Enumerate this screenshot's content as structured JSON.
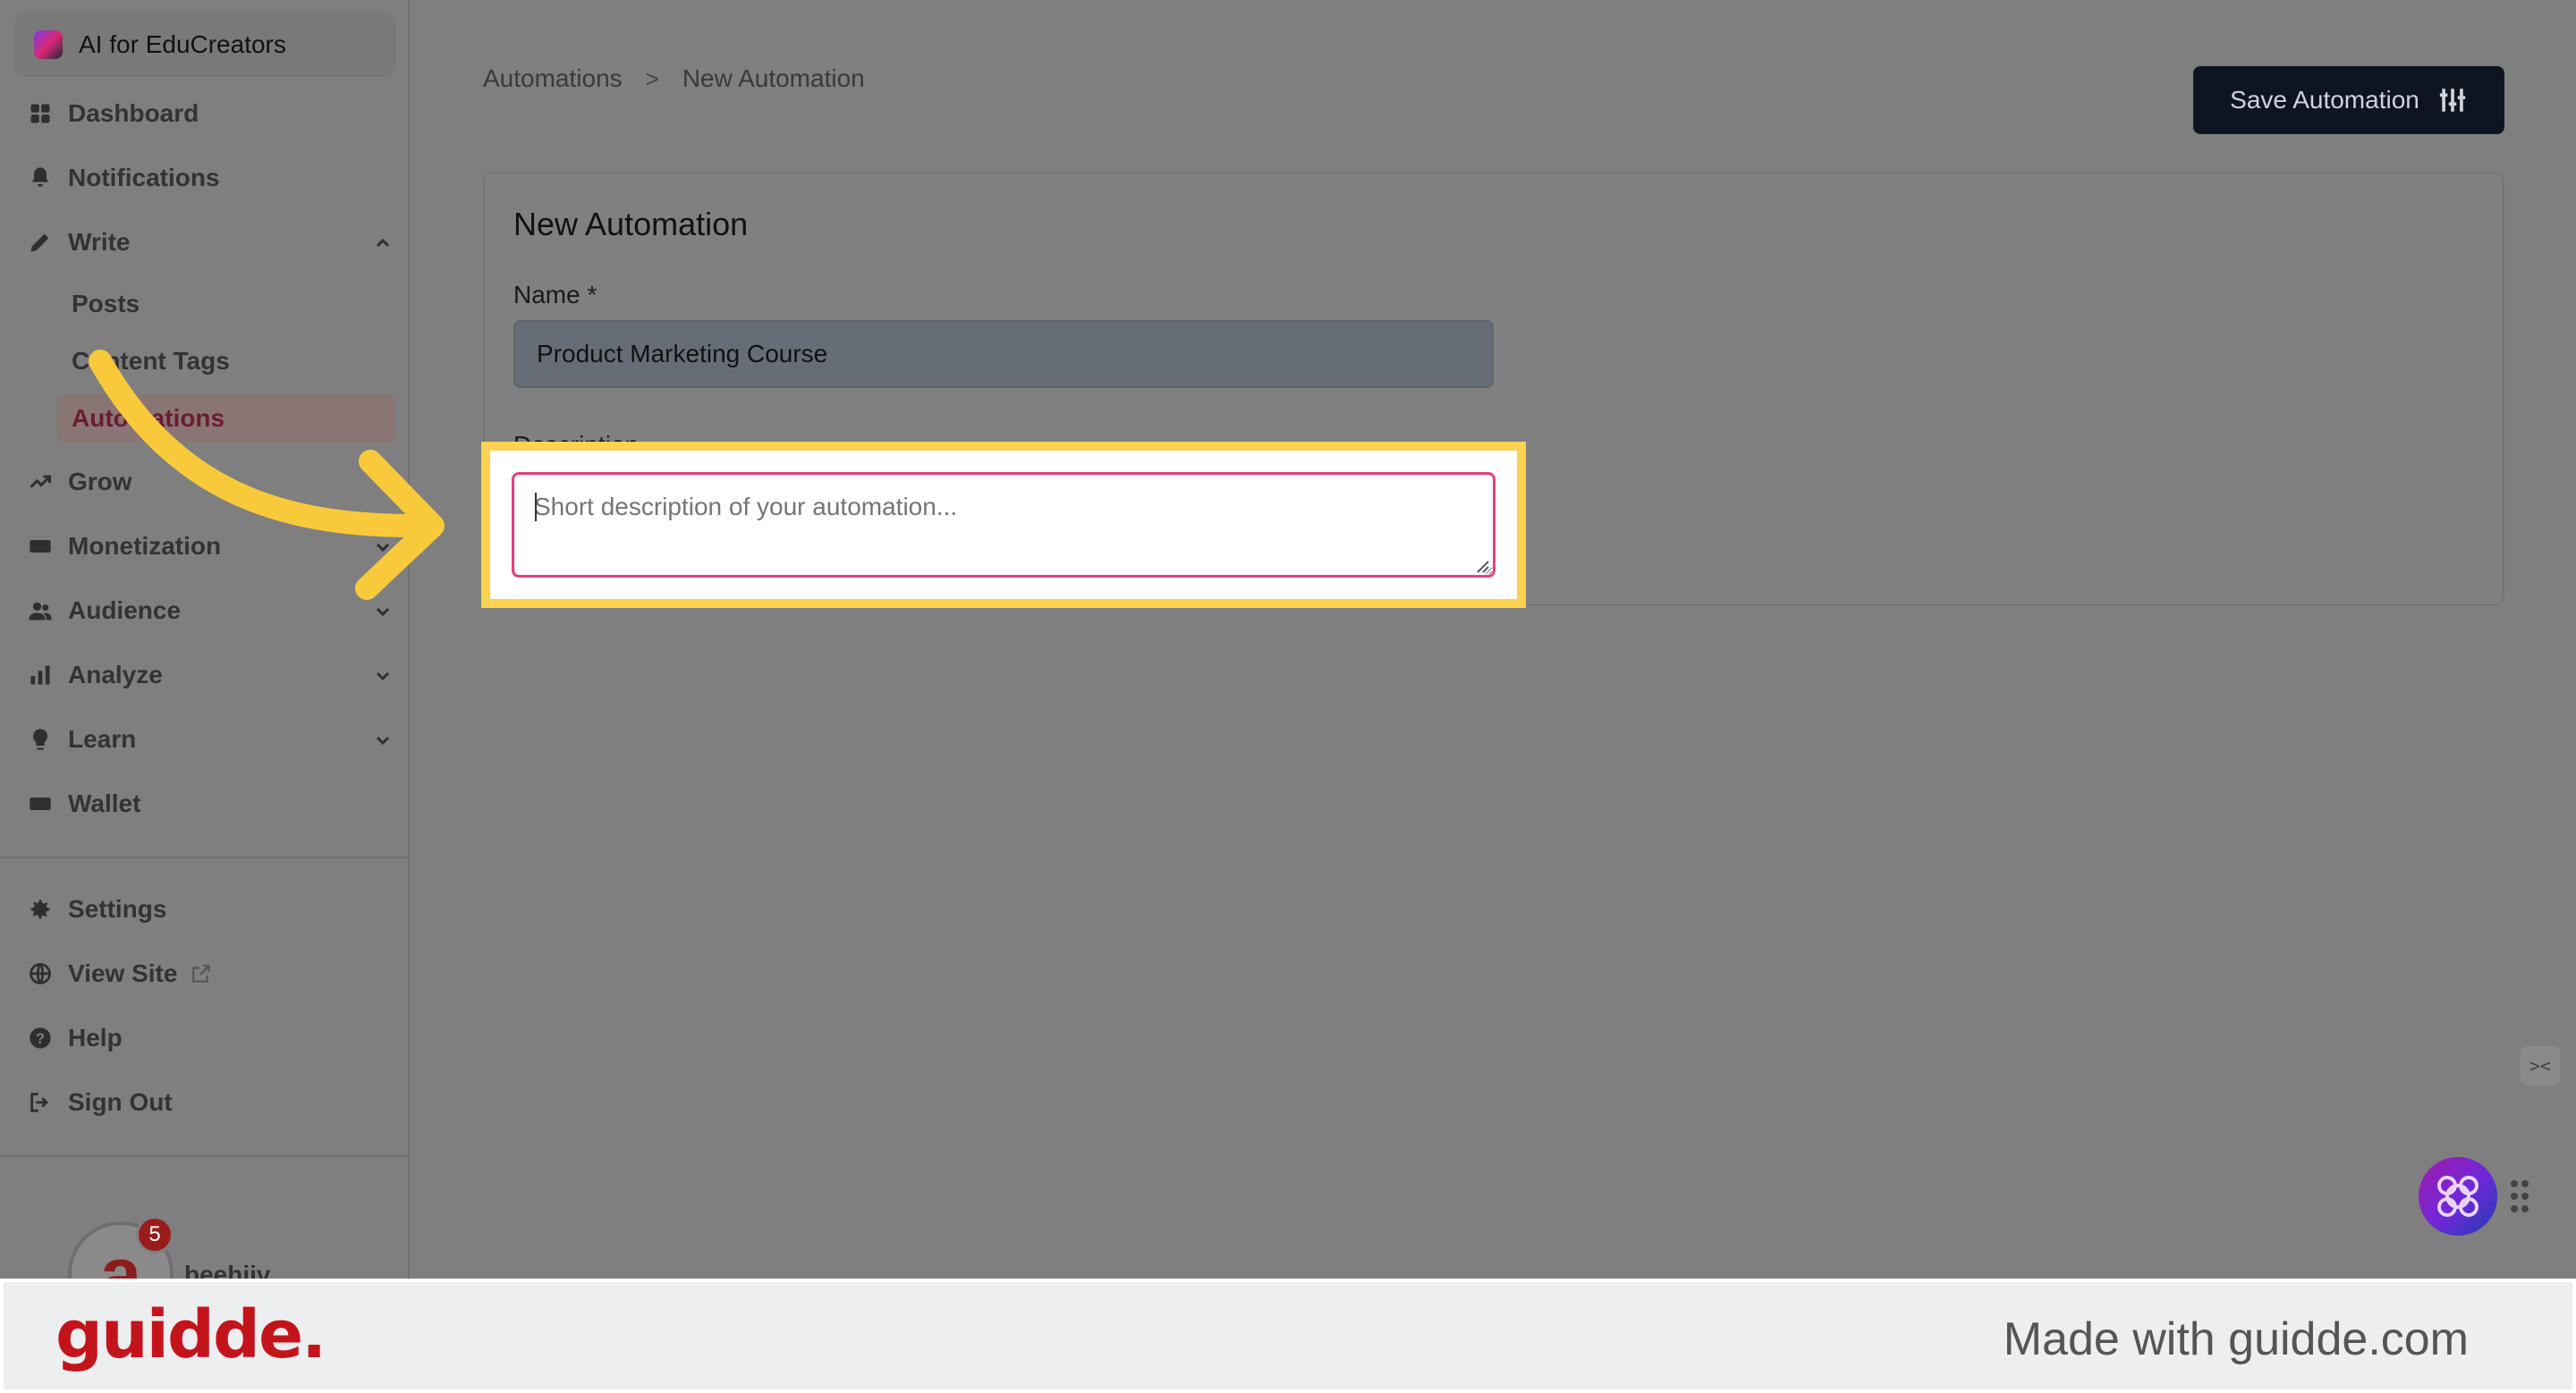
{
  "workspace": {
    "name": "AI for EduCreators"
  },
  "nav": {
    "dashboard": "Dashboard",
    "notifications": "Notifications",
    "write": "Write",
    "write_sub": {
      "posts": "Posts",
      "content_tags": "Content Tags",
      "automations": "Automations"
    },
    "grow": "Grow",
    "monetization": "Monetization",
    "audience": "Audience",
    "analyze": "Analyze",
    "learn": "Learn",
    "wallet": "Wallet",
    "settings": "Settings",
    "view_site": "View Site",
    "help": "Help",
    "sign_out": "Sign Out"
  },
  "account": {
    "name": "beehiiv",
    "notification_count": "5",
    "avatar_letter": "a"
  },
  "breadcrumb": {
    "parent": "Automations",
    "separator": ">",
    "current": "New Automation"
  },
  "toolbar": {
    "save_label": "Save Automation"
  },
  "form": {
    "title": "New Automation",
    "name_label": "Name *",
    "name_value": "Product Marketing Course",
    "description_label": "Description",
    "description_placeholder": "Short description of your automation..."
  },
  "footer": {
    "brand": "guidde.",
    "made_with": "Made with guidde.com"
  },
  "colors": {
    "highlight": "#fcd34d",
    "arrow": "#f9c93c",
    "focus_border": "#e2407f",
    "save_button": "#0f1520",
    "brand": "#c4141b"
  },
  "icons": {
    "dashboard": "grid-icon",
    "notifications": "bell-icon",
    "write": "pencil-icon",
    "grow": "trend-up-icon",
    "monetization": "money-icon",
    "audience": "users-icon",
    "analyze": "bar-chart-icon",
    "learn": "lightbulb-icon",
    "wallet": "wallet-icon",
    "settings": "gear-icon",
    "view_site": "globe-icon",
    "help": "help-icon",
    "sign_out": "sign-out-icon"
  }
}
